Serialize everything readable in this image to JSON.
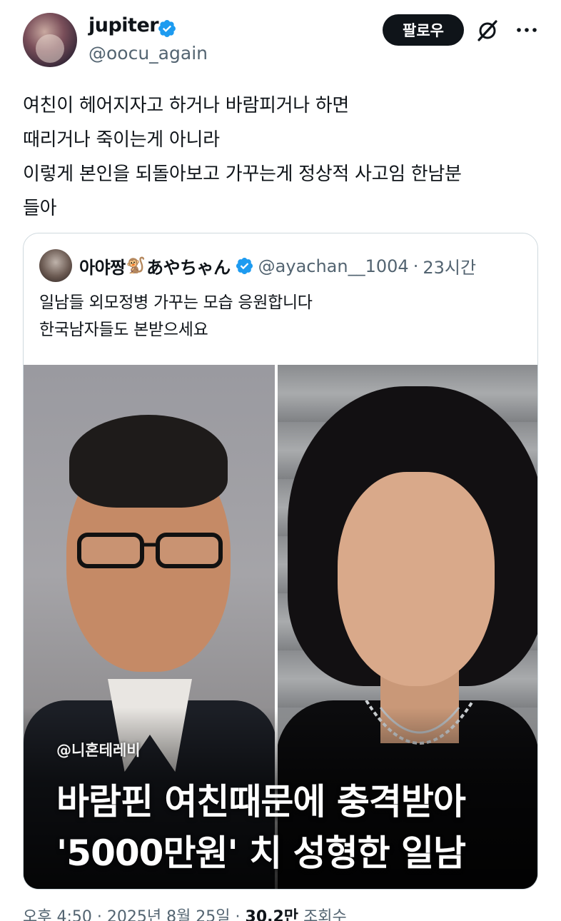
{
  "author": {
    "display_name": "jupiter",
    "handle": "@oocu_again",
    "verified": true
  },
  "actions": {
    "follow_label": "팔로우",
    "grok_icon": "grok-slash-icon",
    "more_icon": "more-horizontal-icon"
  },
  "tweet": {
    "lines": [
      "여친이 헤어지자고 하거나 바람피거나 하면",
      "때리거나 죽이는게 아니라",
      "이렇게 본인을 되돌아보고 가꾸는게 정상적 사고임 한남분",
      "들아"
    ]
  },
  "quote": {
    "name": "아야짱",
    "name_emoji": "🐒",
    "name_jp": "あやちゃん",
    "verified": true,
    "handle": "@ayachan__1004",
    "separator": "·",
    "time": "23시간",
    "lines": [
      "일남들 외모정병 가꾸는 모습 응원합니다",
      "한국남자들도 본받으세요"
    ],
    "media": {
      "watermark": "@니혼테레비",
      "caption_line1": "바람핀 여친때문에 충격받아",
      "caption_line2": "'5000만원' 치 성형한 일남"
    }
  },
  "meta": {
    "text": "오후 4:50 · 2025년 8월 25일 ·",
    "views": "30.2만",
    "views_label": "조회수"
  },
  "colors": {
    "accent_verified": "#1d9bf0",
    "text_primary": "#0f1419",
    "text_secondary": "#536471",
    "border": "#cfd9de"
  }
}
